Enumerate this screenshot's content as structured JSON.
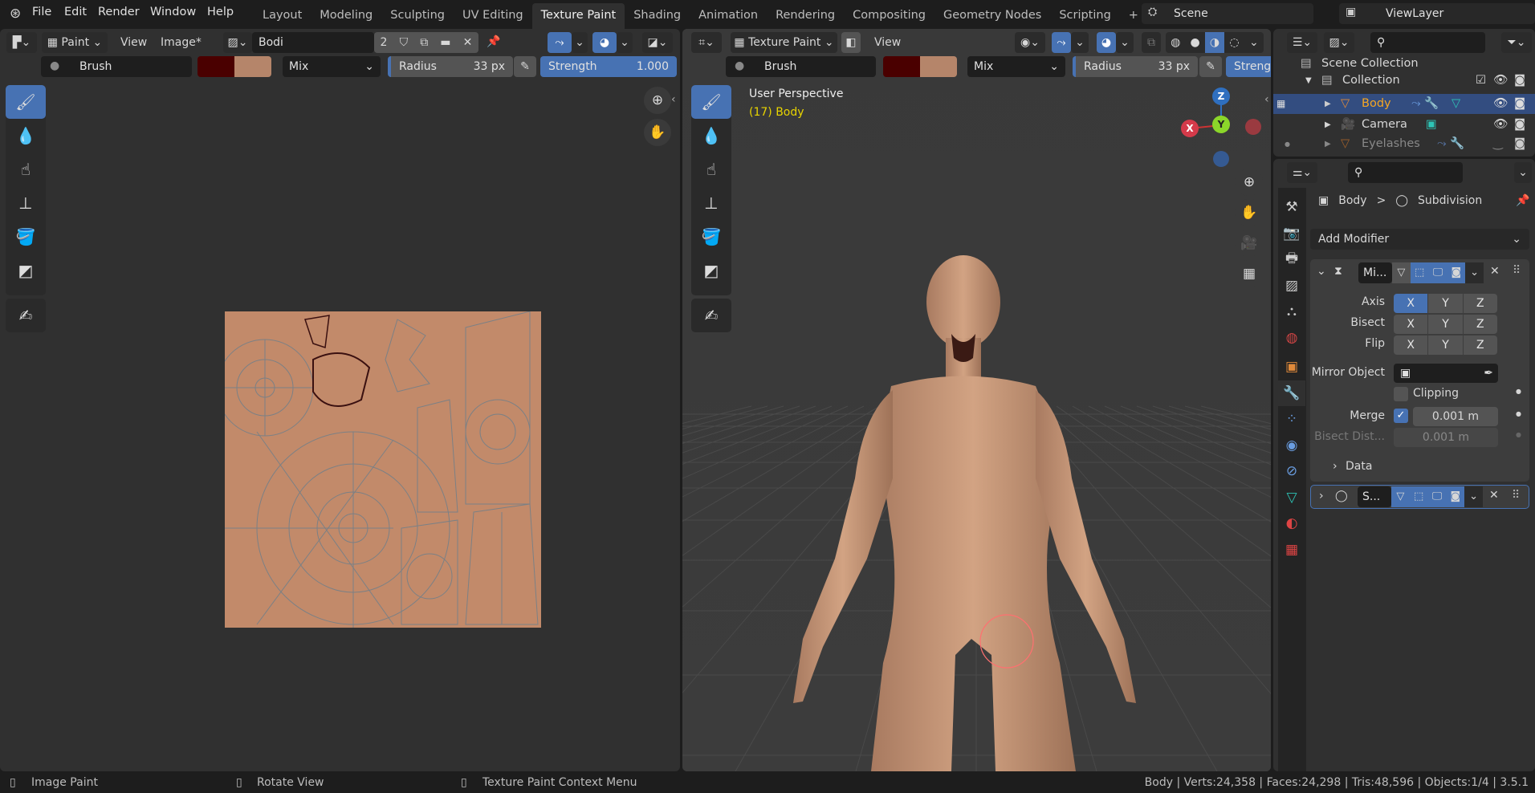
{
  "topbar": {
    "menus": [
      "File",
      "Edit",
      "Render",
      "Window",
      "Help"
    ],
    "workspaces": [
      "Layout",
      "Modeling",
      "Sculpting",
      "UV Editing",
      "Texture Paint",
      "Shading",
      "Animation",
      "Rendering",
      "Compositing",
      "Geometry Nodes",
      "Scripting"
    ],
    "active_workspace": "Texture Paint",
    "add_workspace": "+",
    "scene": "Scene",
    "view_layer": "ViewLayer"
  },
  "image_editor": {
    "mode": "Paint",
    "menus": [
      "View",
      "Image*"
    ],
    "image_name": "Bodi",
    "users": "2",
    "tool_settings": {
      "brush": "Brush",
      "primary_color": "#4a0000",
      "secondary_color": "#b5856a",
      "blend": "Mix",
      "radius_label": "Radius",
      "radius": "33 px",
      "strength_label": "Strength",
      "strength": "1.000"
    },
    "tools": [
      "draw-brush",
      "soften",
      "smear",
      "clone",
      "fill",
      "mask",
      "annotate"
    ]
  },
  "viewport": {
    "mode": "Texture Paint",
    "menus": [
      "View"
    ],
    "overlay_title": "User Perspective",
    "overlay_object": "(17) Body",
    "tool_settings": {
      "brush": "Brush",
      "blend": "Mix",
      "radius_label": "Radius",
      "radius": "33 px",
      "strength_label": "Streng"
    },
    "gizmo": {
      "z": "Z",
      "x": "X",
      "y": "Y"
    },
    "skin_color": "#c89a7a"
  },
  "outliner": {
    "root": "Scene Collection",
    "collection": "Collection",
    "items": [
      {
        "name": "Body",
        "selected": true
      },
      {
        "name": "Camera",
        "selected": false
      },
      {
        "name": "Eyelashes",
        "selected": false
      }
    ]
  },
  "properties": {
    "breadcrumb": {
      "object": "Body",
      "sep": ">",
      "modifier": "Subdivision"
    },
    "add_modifier": "Add Modifier",
    "mirror": {
      "name": "Mi...",
      "axis_label": "Axis",
      "bisect_label": "Bisect",
      "flip_label": "Flip",
      "axes": [
        "X",
        "Y",
        "Z"
      ],
      "mirror_object_label": "Mirror Object",
      "clipping_label": "Clipping",
      "clipping": false,
      "merge_label": "Merge",
      "merge": true,
      "merge_value": "0.001 m",
      "bisect_distance_label": "Bisect Dist...",
      "bisect_distance": "0.001 m",
      "data_label": "Data"
    },
    "subdivision": {
      "name": "S..."
    }
  },
  "statusbar": {
    "left": "Image Paint",
    "middle": "Rotate View",
    "right": "Texture Paint Context Menu",
    "stats": "Body | Verts:24,358 | Faces:24,298 | Tris:48,596 | Objects:1/4 | 3.5.1"
  }
}
